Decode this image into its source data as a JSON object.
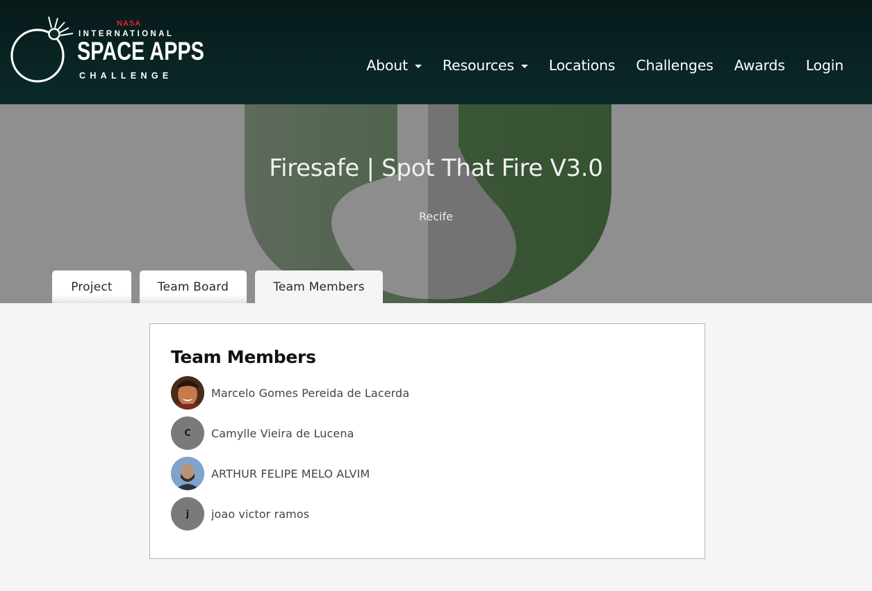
{
  "logo": {
    "nasa": "NASA",
    "line1": "INTERNATIONAL",
    "line2": "SPACE APPS",
    "line3": "CHALLENGE"
  },
  "nav": {
    "items": [
      {
        "label": "About",
        "dropdown": true
      },
      {
        "label": "Resources",
        "dropdown": true
      },
      {
        "label": "Locations",
        "dropdown": false
      },
      {
        "label": "Challenges",
        "dropdown": false
      },
      {
        "label": "Awards",
        "dropdown": false
      },
      {
        "label": "Login",
        "dropdown": false
      }
    ]
  },
  "hero": {
    "title": "Firesafe | Spot That Fire V3.0",
    "location": "Recife"
  },
  "tabs": [
    {
      "label": "Project",
      "active": false
    },
    {
      "label": "Team Board",
      "active": false
    },
    {
      "label": "Team Members",
      "active": true
    }
  ],
  "team": {
    "heading": "Team Members",
    "members": [
      {
        "name": "Marcelo Gomes Pereida de Lacerda",
        "initial": "",
        "photo": true
      },
      {
        "name": "Camylle Vieira de Lucena",
        "initial": "C",
        "photo": false
      },
      {
        "name": "ARTHUR FELIPE MELO ALVIM",
        "initial": "",
        "photo": true
      },
      {
        "name": "joao victor ramos",
        "initial": "j",
        "photo": false
      }
    ]
  },
  "colors": {
    "header_bg": "#0b2a2a",
    "nasa_red": "#e32330",
    "hero_bg": "#8f8f8f",
    "page_bg": "#f5f5f5"
  }
}
